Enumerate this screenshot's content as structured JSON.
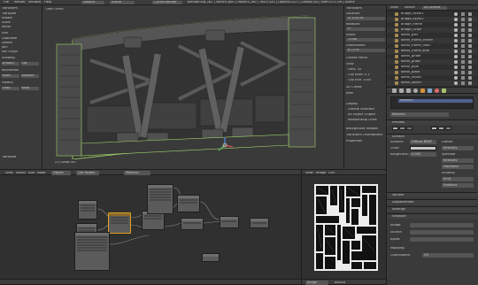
{
  "top_bar": {
    "menus": [
      "File",
      "Render",
      "Window",
      "Help"
    ],
    "layout": "Default",
    "scene": "Scene",
    "engine": "Cycles Render",
    "stats": "blender.org 262 | Verts:4,800 | Faces:4,760 | Tris:9,520 | Objects:1/27 | Lamps:0/0 | Mem:372.1M | Scene"
  },
  "left_toolbar": {
    "sections": [
      {
        "header": "Transform",
        "items": [
          "Translate",
          "Rotate",
          "Scale",
          "Mirror"
        ]
      },
      {
        "header": "Edit",
        "items": [
          "Duplicate",
          "Delete",
          "Join",
          "Set Origin"
        ]
      },
      {
        "header": "Shading",
        "items": [
          "Smooth",
          "Flat"
        ]
      },
      {
        "header": "Keyframes",
        "items": [
          "Insert",
          "Remove"
        ]
      },
      {
        "header": "History",
        "items": [
          "Undo",
          "Redo"
        ]
      }
    ],
    "operator": "Translate"
  },
  "viewport": {
    "title": "User Ortho",
    "object_label": "(1) Grate.007",
    "header_items": [
      "View",
      "Select",
      "Object",
      "Object Mode",
      "Local"
    ]
  },
  "n_panel": {
    "sections": [
      "Transform",
      "Grease Pencil",
      "View",
      "3D Cursor",
      "Item",
      "Display",
      "Background Images",
      "Transform Orientations",
      "Properties"
    ],
    "fields": [
      {
        "label": "Location:",
        "value": "X: 0.00 m"
      },
      {
        "label": "Rotation:",
        "value": "0°"
      },
      {
        "label": "Scale:",
        "value": "1.000"
      },
      {
        "label": "Dimensions:",
        "value": "6.72 m"
      }
    ],
    "view_fields": [
      "Lens: 35",
      "Clip Start: 0.1",
      "Clip End: 1000"
    ],
    "toggles": [
      "Outline Selected",
      "All Object Origins",
      "Relationship Lines"
    ]
  },
  "node_editor": {
    "header_items": [
      "View",
      "Select",
      "Add",
      "Node",
      "Object",
      "Use Nodes",
      "Material"
    ],
    "material": "Material"
  },
  "image_editor": {
    "header_items": [
      "View",
      "Image",
      "UVs"
    ],
    "image_name": "Image",
    "footer": "Texture"
  },
  "outliner": {
    "header_items": [
      "View",
      "Search",
      "All Scenes"
    ],
    "rows": [
      "bridge_cover1",
      "bridge_cover2",
      "bridge_frame",
      "bridge_Grate",
      "damn_part",
      "damn_frame_centre",
      "damn_frame_main",
      "damn_frame_side",
      "damn_girder",
      "damn_grate",
      "damn_pipe",
      "damn_plate",
      "damn_shield",
      "damn_wheel"
    ]
  },
  "properties": {
    "header_icons": [
      "render",
      "layers",
      "scene",
      "world",
      "object",
      "modifiers",
      "material",
      "texture"
    ],
    "material_list": [
      "Material"
    ],
    "material_name": "Material",
    "sections": [
      "Preview",
      "Surface",
      "Volume",
      "Displacement",
      "Settings",
      "Viewport"
    ],
    "surface_rows": [
      {
        "label": "Surface:",
        "value": "Diffuse BSDF"
      },
      {
        "label": "Color:",
        "value": ""
      },
      {
        "label": "Roughness:",
        "value": "0.000"
      }
    ],
    "right_fields": [
      "Diffuse",
      "Intensity",
      "Specular",
      "Intensity",
      "Hardness",
      "Shading",
      "Emit",
      "Ambient"
    ],
    "footer": [
      "Image:",
      "Source:",
      "Alpha:",
      "Mapping:",
      "Coordinates:",
      "UV"
    ],
    "swatch_colors": [
      "#b0b0b0",
      "#8c8c8c",
      "#6f6f6f",
      "#bdbdbd",
      "#a8a8a8",
      "#7c7c7c"
    ]
  },
  "colors": {
    "accent": "#e0a020",
    "selected_outline": "#a3d36b",
    "background": "#2b2b2b",
    "viewport_bg": "#3a3a3a"
  }
}
